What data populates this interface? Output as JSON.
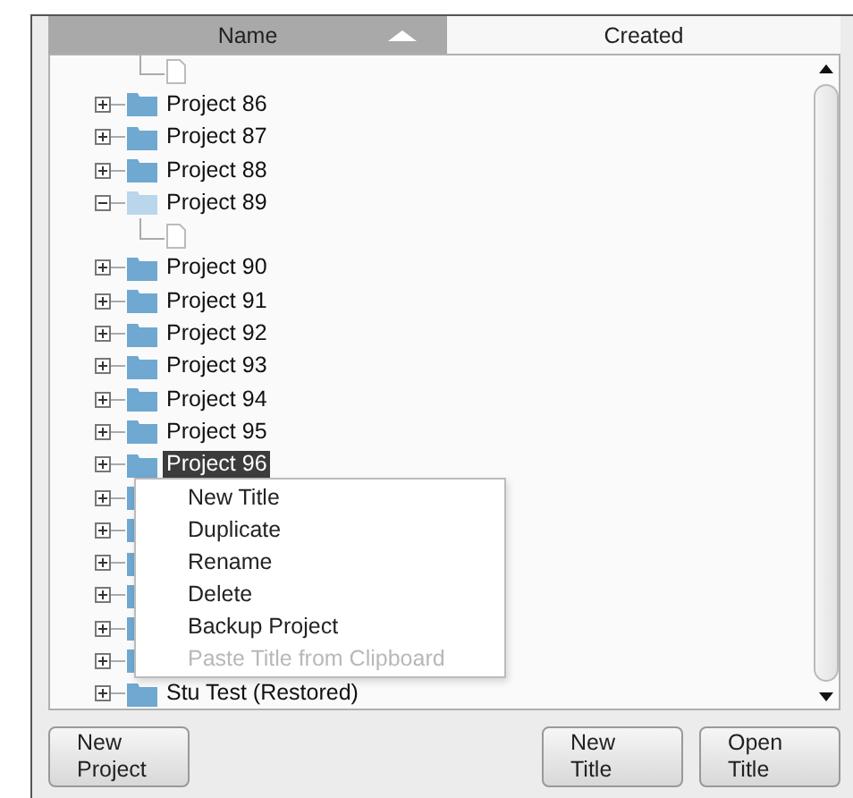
{
  "header": {
    "columns": [
      {
        "label": "Name",
        "selected": true
      },
      {
        "label": "Created",
        "selected": false
      }
    ]
  },
  "tree": [
    {
      "kind": "document"
    },
    {
      "kind": "project",
      "name": "Project 86",
      "expanded": false,
      "selected": false
    },
    {
      "kind": "project",
      "name": "Project 87",
      "expanded": false,
      "selected": false
    },
    {
      "kind": "project",
      "name": "Project 88",
      "expanded": false,
      "selected": false
    },
    {
      "kind": "project",
      "name": "Project 89",
      "expanded": true,
      "selected": false,
      "children": [
        {
          "kind": "document"
        }
      ]
    },
    {
      "kind": "project",
      "name": "Project 90",
      "expanded": false,
      "selected": false
    },
    {
      "kind": "project",
      "name": "Project 91",
      "expanded": false,
      "selected": false
    },
    {
      "kind": "project",
      "name": "Project 92",
      "expanded": false,
      "selected": false
    },
    {
      "kind": "project",
      "name": "Project 93",
      "expanded": false,
      "selected": false
    },
    {
      "kind": "project",
      "name": "Project 94",
      "expanded": false,
      "selected": false
    },
    {
      "kind": "project",
      "name": "Project 95",
      "expanded": false,
      "selected": false
    },
    {
      "kind": "project",
      "name": "Project 96",
      "expanded": false,
      "selected": true
    },
    {
      "kind": "project",
      "expanded": false
    },
    {
      "kind": "project",
      "expanded": false
    },
    {
      "kind": "project",
      "expanded": false
    },
    {
      "kind": "project",
      "expanded": false
    },
    {
      "kind": "project",
      "expanded": false
    },
    {
      "kind": "project",
      "expanded": false
    },
    {
      "kind": "project",
      "name": "Stu Test (Restored)",
      "expanded": false,
      "selected": false
    }
  ],
  "context_menu": [
    {
      "label": "New Title",
      "disabled": false
    },
    {
      "label": "Duplicate",
      "disabled": false
    },
    {
      "label": "Rename",
      "disabled": false
    },
    {
      "label": "Delete",
      "disabled": false
    },
    {
      "label": "Backup Project",
      "disabled": false
    },
    {
      "label": "Paste Title from Clipboard",
      "disabled": true
    }
  ],
  "left_buttons": [
    "New Project"
  ],
  "right_buttons": [
    "New Title",
    "Open Title"
  ]
}
